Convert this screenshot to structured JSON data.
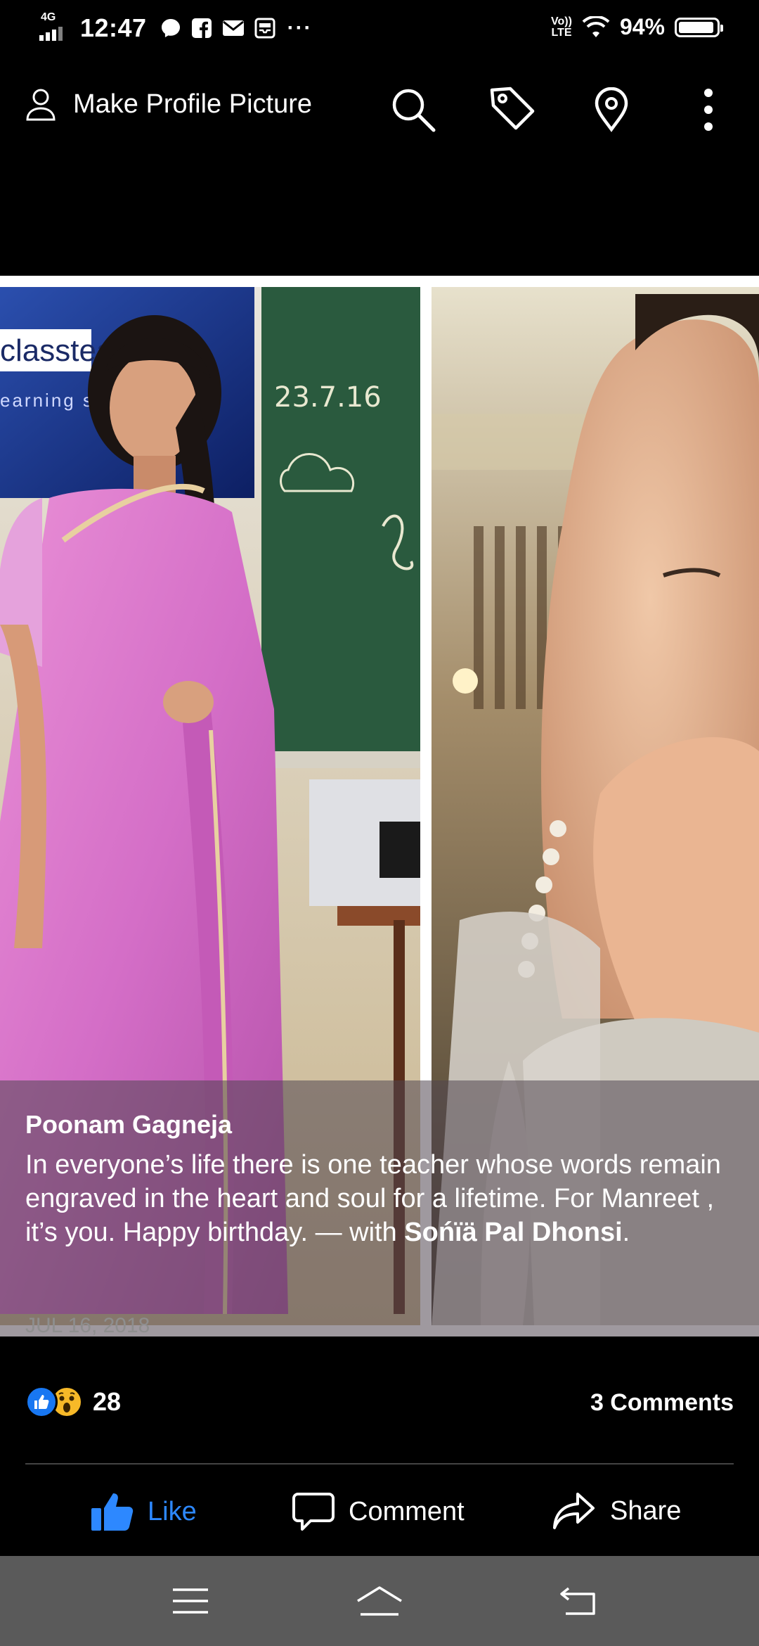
{
  "status_bar": {
    "network": "4G",
    "time": "12:47",
    "lte_label_top": "Vo))",
    "lte_label_bottom": "LTE",
    "battery_pct_text": "94%",
    "battery_level": 0.94,
    "notification_icons": [
      "chat-bubble-icon",
      "facebook-icon",
      "mail-icon",
      "inbox-icon"
    ],
    "overflow": "···"
  },
  "toolbar": {
    "profile_label": "Make Profile Picture",
    "actions": [
      "search-icon",
      "tag-icon",
      "location-pin-icon",
      "more-vertical-icon"
    ]
  },
  "photos": {
    "left": {
      "board_text": "classtea",
      "board_subtext": "earning s",
      "chalk_date": "23.7.16"
    }
  },
  "caption": {
    "author": "Poonam Gagneja",
    "text": "In everyone’s life there is one teacher whose words remain engraved in the heart and soul for a lifetime. For  Manreet , it’s you. Happy birthday. — with ",
    "tagged": "Sońïä Pal Dhonsi",
    "end": ".",
    "date": "JUL 16, 2018"
  },
  "reactions": {
    "types": [
      "like-reaction-icon",
      "wow-reaction-icon"
    ],
    "count": "28",
    "comments": "3 Comments"
  },
  "actions": {
    "like": "Like",
    "comment": "Comment",
    "share": "Share"
  },
  "nav_bar": {
    "buttons": [
      "menu-icon",
      "home-icon",
      "back-icon"
    ]
  },
  "colors": {
    "background": "#000000",
    "like_blue": "#2d88ff",
    "fb_blue": "#1877f2",
    "wow_yellow": "#f7b928",
    "nav_gray": "#5a5a5a",
    "date_gray": "#8e8e8e"
  }
}
